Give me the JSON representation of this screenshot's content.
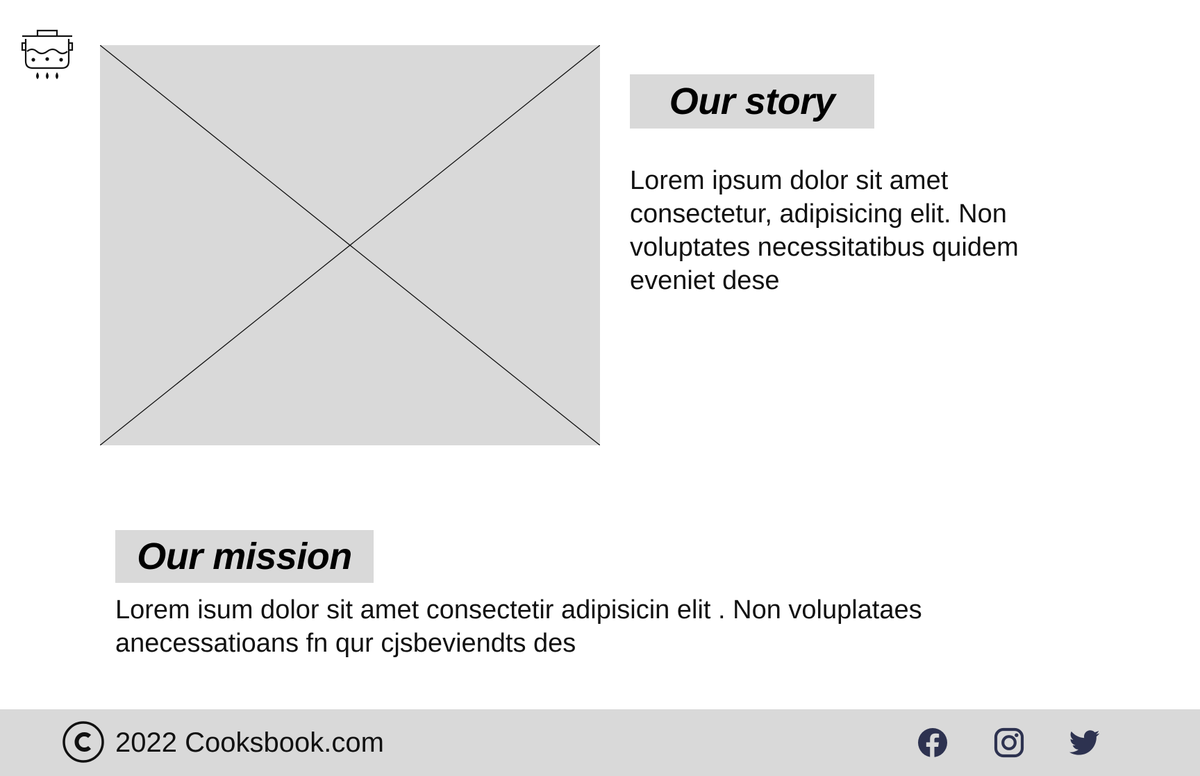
{
  "colors": {
    "placeholder": "#d9d9d9",
    "social_icon": "#2d3250",
    "text": "#111111"
  },
  "header": {
    "logo_icon": "cooking-pot-icon"
  },
  "story": {
    "image_icon": "image-placeholder",
    "heading": "Our story",
    "body": "Lorem ipsum dolor sit amet consectetur, adipisicing elit. Non voluptates necessitatibus quidem eveniet dese"
  },
  "mission": {
    "heading": "Our mission",
    "body": "Lorem isum dolor sit amet consectetir adipisicin elit . Non voluplataes anecessatioans fn qur cjsbeviendts des"
  },
  "footer": {
    "copyright_icon": "copyright-icon",
    "text": "2022 Cooksbook.com",
    "social": [
      {
        "name": "facebook",
        "icon": "facebook-icon"
      },
      {
        "name": "instagram",
        "icon": "instagram-icon"
      },
      {
        "name": "twitter",
        "icon": "twitter-icon"
      }
    ]
  }
}
